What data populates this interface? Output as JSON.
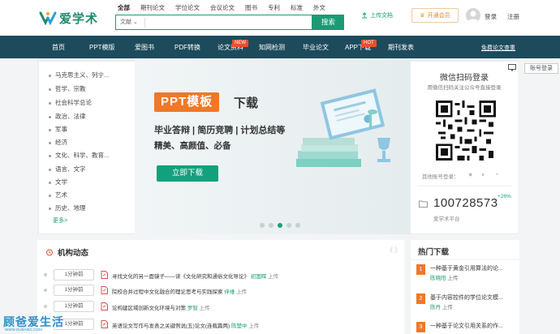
{
  "header": {
    "logo_text": "爱学术",
    "search_tabs": [
      "全部",
      "期刊论文",
      "学位论文",
      "会议论文",
      "图书",
      "专利",
      "标准",
      "外文"
    ],
    "search_category": "文献",
    "search_value": "",
    "search_button": "搜索",
    "upload_label": "上传文档",
    "member_label": "开通会员",
    "login_label": "登录",
    "register_label": "注册"
  },
  "nav": {
    "items": [
      "首页",
      "PPT模版",
      "爱图书",
      "PDF转换",
      "论文资料",
      "知网检测",
      "毕业论文",
      "APP下载",
      "期刊发表",
      "免费论文查重"
    ],
    "badge_new": "NEW",
    "badge_hot": "HOT"
  },
  "sidebar": {
    "items": [
      "马克思主义、列宁...",
      "哲学、宗教",
      "社会科学总论",
      "政治、法律",
      "军事",
      "经济",
      "文化、科学、教育...",
      "语言、文字",
      "文学",
      "艺术",
      "历史、地理"
    ],
    "more_label": "更多>"
  },
  "promo": {
    "tag": "PPT模板",
    "tag_suffix": "下载",
    "line1": "毕业答辩 | 简历竞聘 | 计划总结等",
    "line2": "精美、高颜值、必备",
    "button": "立即下载",
    "slide_count": 5,
    "active_slide": 3
  },
  "login_panel": {
    "title": "微信扫码登录",
    "subtitle": "用微信扫码关注公众号直接登录",
    "other_label": "其他账号登录：",
    "counter": "100728573",
    "counter_growth": "+26%",
    "counter_label": "爱学术平台",
    "account_login": "账号登录"
  },
  "news": {
    "title": "机构动态",
    "arrows": "〈 〉",
    "rows": [
      {
        "time": "1分钟前",
        "text": "寻找文化的另一面镜子——读《文化研究和通俗文化导论》",
        "user": "初国晖",
        "action": "上传"
      },
      {
        "time": "1分钟前",
        "text": "院校合并过程中文化融合的理论思考与实践探索",
        "user": "伴维",
        "action": "上传"
      },
      {
        "time": "1分钟前",
        "text": "论构建区域创新文化环境与对策",
        "user": "罗智",
        "action": "上传"
      },
      {
        "time": "1分钟前",
        "text": "英语论文写作与发表之关键例说(五)论文(连载篇两)",
        "user": "陈楚中",
        "action": "上传"
      }
    ]
  },
  "hot": {
    "title": "热门下载",
    "items": [
      {
        "num": "1",
        "title": "一种基于黄金引用算法的论...",
        "author": "陈晓阳",
        "action": "上传"
      },
      {
        "num": "2",
        "title": "基于内容控件的学位论文模...",
        "author": "陈丹",
        "action": "上传"
      },
      {
        "num": "3",
        "title": "一种基于论文引用关系的作...",
        "author": "",
        "action": ""
      }
    ],
    "colors": [
      "#f07828",
      "#f07828",
      "#f07828"
    ]
  },
  "watermark": {
    "text": "顾爸爱生活",
    "sub": "WWW.GUBAIEC.COM"
  },
  "colors": {
    "brand": "#1a9b74",
    "nav": "#1d4b5c",
    "accent": "#f07828"
  }
}
